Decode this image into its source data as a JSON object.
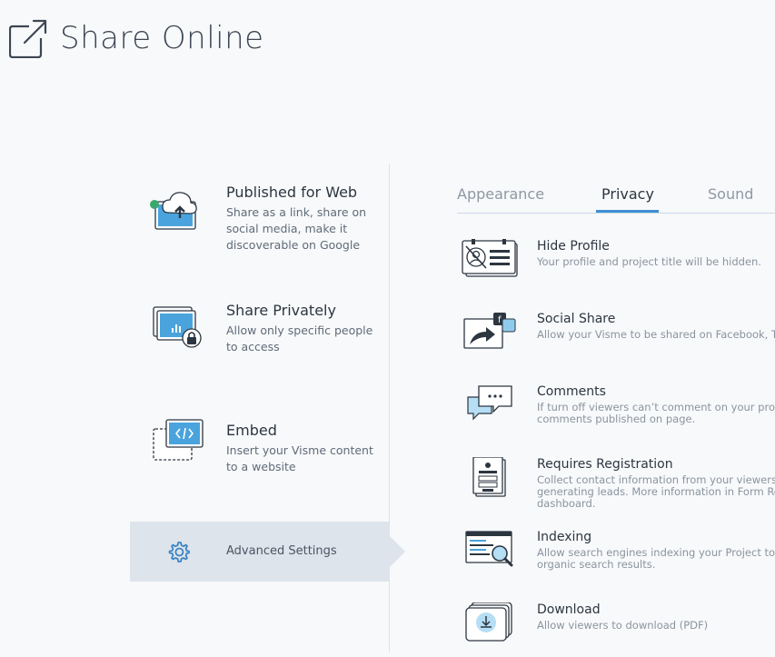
{
  "header": {
    "title": "Share Online",
    "icon": "external-share-icon"
  },
  "options": [
    {
      "title": "Published for Web",
      "desc": "Share as a link, share on social media, make it discoverable on Google",
      "icon": "cloud-upload-icon"
    },
    {
      "title": "Share Privately",
      "desc": "Allow only specific people to access",
      "icon": "private-lock-icon"
    },
    {
      "title": "Embed",
      "desc": "Insert your Visme content to a website",
      "icon": "embed-code-icon"
    }
  ],
  "advanced": {
    "label": "Advanced Settings",
    "icon": "gear-icon"
  },
  "tabs": [
    {
      "label": "Appearance",
      "active": false
    },
    {
      "label": "Privacy",
      "active": true
    },
    {
      "label": "Sound",
      "active": false
    }
  ],
  "privacy_rows": [
    {
      "title": "Hide Profile",
      "desc": [
        "Your profile and project title will be hidden."
      ],
      "icon": "hide-profile-icon"
    },
    {
      "title": "Social Share",
      "desc": [
        "Allow your Visme to be shared on Facebook, Tw"
      ],
      "icon": "social-share-icon"
    },
    {
      "title": "Comments",
      "desc": [
        "If turn off viewers can’t comment on your proje",
        "comments published on page."
      ],
      "icon": "comments-icon"
    },
    {
      "title": "Requires Registration",
      "desc": [
        "Collect contact information from your viewers,",
        "generating leads. More information in Form Re",
        "dashboard."
      ],
      "icon": "registration-form-icon"
    },
    {
      "title": "Indexing",
      "desc": [
        "Allow search engines indexing your Project to a",
        "organic search results."
      ],
      "icon": "search-indexing-icon"
    },
    {
      "title": "Download",
      "desc": [
        "Allow viewers to download (PDF)"
      ],
      "icon": "download-icon"
    }
  ],
  "colors": {
    "accent": "#3f8fd2",
    "status_dot": "#3aa76d",
    "icon_fill": "#4aa3dc",
    "panel": "#dde4eb"
  }
}
